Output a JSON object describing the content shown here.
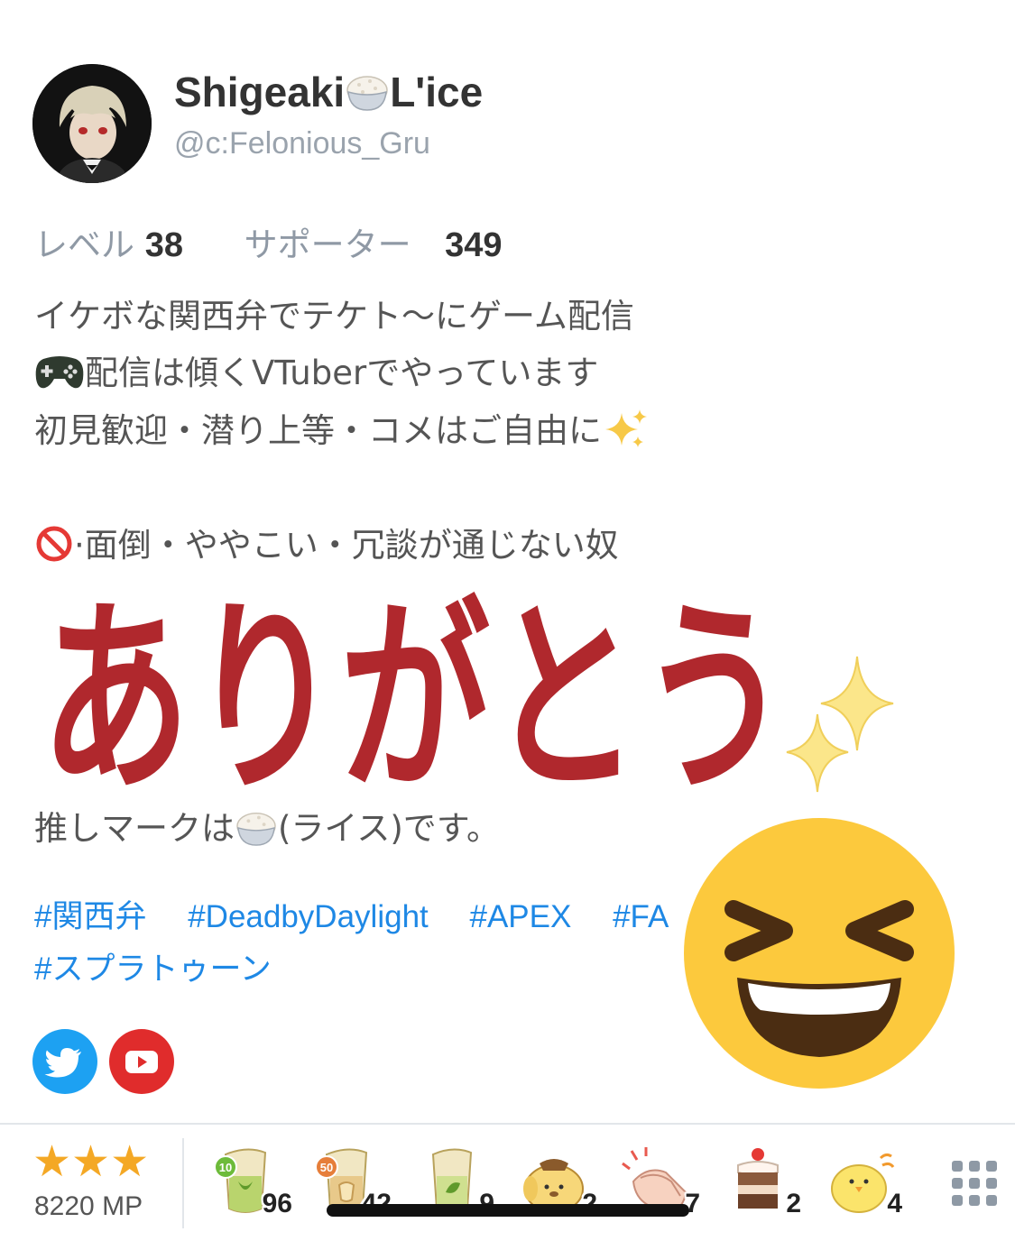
{
  "profile": {
    "name_part1": "Shigeaki",
    "name_part2": "L'ice",
    "handle": "@c:Felonious_Gru",
    "avatar_icon": "avatar-anime-character"
  },
  "stats": {
    "level_label": "レベル",
    "level_value": "38",
    "supporter_label": "サポーター",
    "supporter_value": "349"
  },
  "bio": {
    "line1": "イケボな関西弁でテケト〜にゲーム配信",
    "line2": "配信は傾くVTuberでやっています",
    "line3": "初見歓迎・潜り上等・コメはご自由に",
    "line4": "·面倒・ややこい・冗談が通じない奴",
    "line5": "推しマークは",
    "line5_suffix": "(ライス)です。"
  },
  "tags": [
    "#関西弁",
    "#DeadbyDaylight",
    "#APEX",
    "#FA",
    "#スプラトゥーン"
  ],
  "social": {
    "twitter_icon": "twitter-icon",
    "youtube_icon": "youtube-icon"
  },
  "bottom_bar": {
    "stars": "★★★",
    "mp": "8220 MP",
    "items": [
      {
        "icon": "tea-cup-10-icon",
        "count": "96"
      },
      {
        "icon": "tea-cup-50-icon",
        "count": "42"
      },
      {
        "icon": "tea-cup-icon",
        "count": "9"
      },
      {
        "icon": "pompompurin-icon",
        "count": "2"
      },
      {
        "icon": "clapping-hands-icon",
        "count": "7"
      },
      {
        "icon": "cake-icon",
        "count": "2"
      },
      {
        "icon": "chick-icon",
        "count": "4"
      }
    ],
    "badge_10": "10",
    "badge_50": "50"
  },
  "overlay": {
    "arigatou_text": "ありがとう",
    "sparkle_icon": "sparkles-icon",
    "laugh_icon": "laughing-face-icon"
  },
  "colors": {
    "accent_blue": "#1e88e5",
    "twitter": "#1da1f2",
    "youtube": "#e02c2c",
    "star": "#f4a825",
    "arigatou_red": "#b0282d",
    "emoji_yellow": "#fcc93d"
  }
}
